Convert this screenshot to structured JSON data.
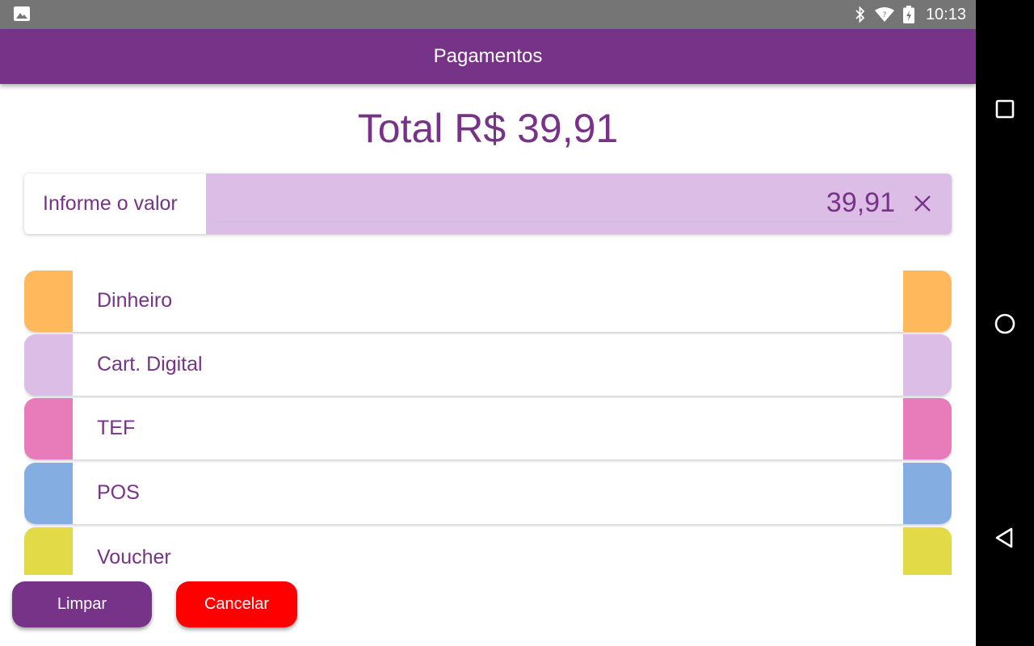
{
  "status_bar": {
    "time": "10:13",
    "icons": [
      "image-icon",
      "bluetooth-icon",
      "wifi-icon",
      "battery-icon"
    ]
  },
  "app_bar": {
    "title": "Pagamentos"
  },
  "total": {
    "text": "Total R$ 39,91"
  },
  "value_input": {
    "label": "Informe o valor",
    "value": "39,91",
    "clear_icon": "close-icon"
  },
  "payment_methods": [
    {
      "label": "Dinheiro",
      "color": "#ffb85c"
    },
    {
      "label": "Cart. Digital",
      "color": "#dcbde6"
    },
    {
      "label": "TEF",
      "color": "#e87cba"
    },
    {
      "label": "POS",
      "color": "#84ade2"
    },
    {
      "label": "Voucher",
      "color": "#e3da48"
    }
  ],
  "buttons": {
    "clear_label": "Limpar",
    "cancel_label": "Cancelar"
  },
  "colors": {
    "primary": "#763387",
    "input_bg": "#dcbde6",
    "cancel": "#ff0000",
    "status_bar": "#757575"
  },
  "nav_bar": {
    "icons": [
      "recents-icon",
      "home-icon",
      "back-icon"
    ]
  }
}
